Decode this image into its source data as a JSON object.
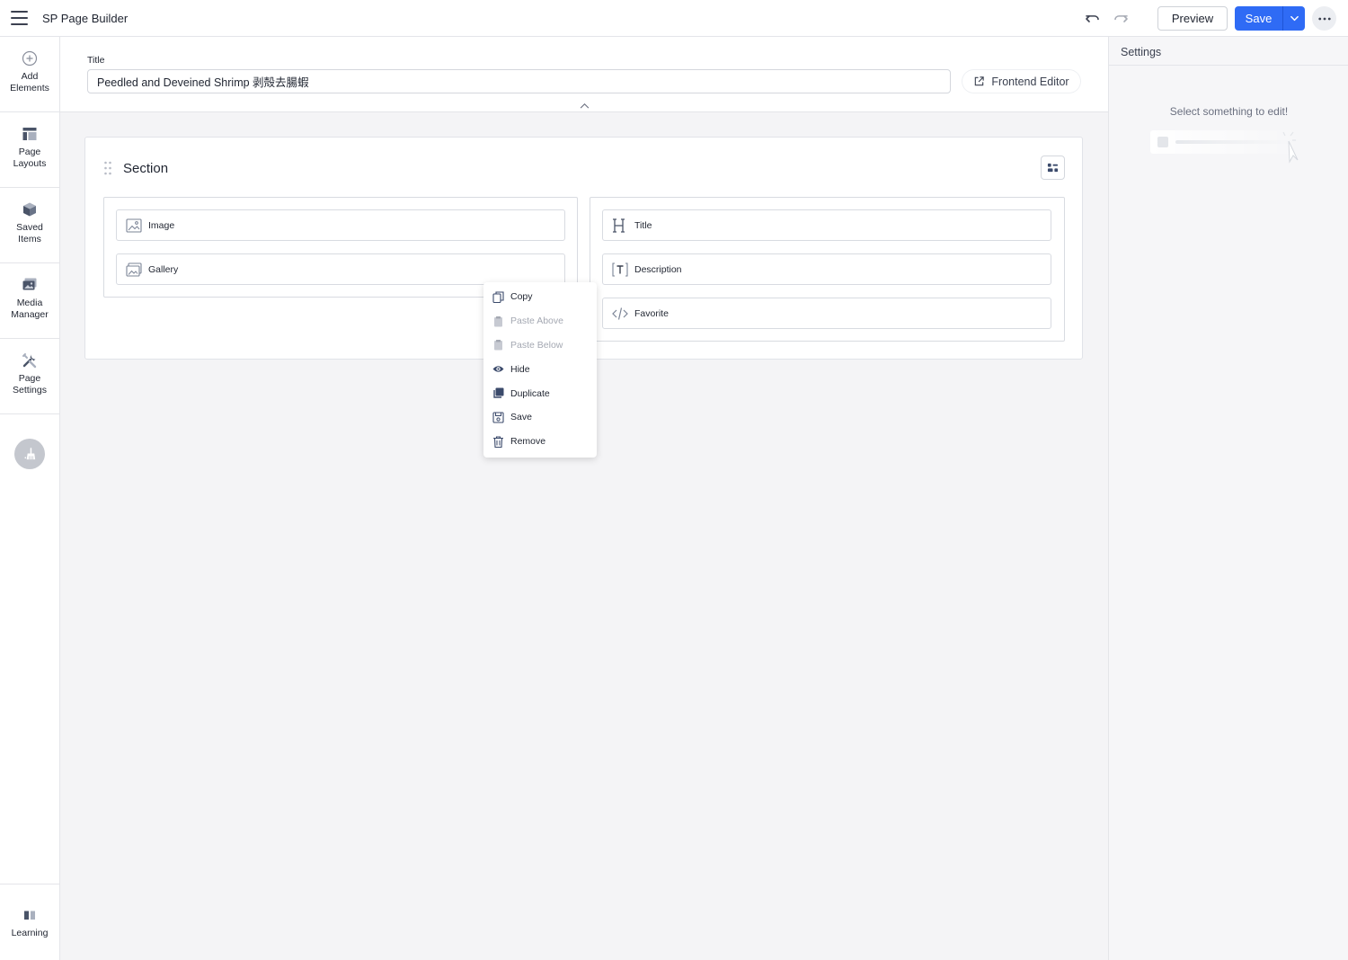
{
  "app": {
    "title": "SP Page Builder"
  },
  "toolbar": {
    "preview_label": "Preview",
    "save_label": "Save"
  },
  "sidebar": {
    "items": [
      {
        "label": "Add\nElements",
        "icon": "plus-circle-icon"
      },
      {
        "label": "Page\nLayouts",
        "icon": "layout-icon"
      },
      {
        "label": "Saved\nItems",
        "icon": "box-icon"
      },
      {
        "label": "Media\nManager",
        "icon": "media-icon"
      },
      {
        "label": "Page\nSettings",
        "icon": "tools-icon"
      }
    ],
    "bottom_label": "Learning"
  },
  "title_area": {
    "label": "Title",
    "value": "Peedled and Deveined Shrimp 剥殻去腸蝦",
    "frontend_editor_label": "Frontend Editor"
  },
  "section": {
    "title": "Section",
    "left_column": [
      {
        "label": "Image",
        "icon": "image-icon"
      },
      {
        "label": "Gallery",
        "icon": "gallery-icon"
      }
    ],
    "right_column": [
      {
        "label": "Title",
        "icon": "heading-icon"
      },
      {
        "label": "Description",
        "icon": "text-icon"
      },
      {
        "label": "Favorite",
        "icon": "code-icon"
      }
    ]
  },
  "context_menu": {
    "items": [
      {
        "label": "Copy",
        "disabled": false
      },
      {
        "label": "Paste Above",
        "disabled": true
      },
      {
        "label": "Paste Below",
        "disabled": true
      },
      {
        "label": "Hide",
        "disabled": false
      },
      {
        "label": "Duplicate",
        "disabled": false
      },
      {
        "label": "Save",
        "disabled": false
      },
      {
        "label": "Remove",
        "disabled": false
      }
    ]
  },
  "settings": {
    "header": "Settings",
    "empty_message": "Select something to edit!"
  },
  "colors": {
    "accent": "#2f6bf5",
    "icon": "#3b4a6b"
  }
}
